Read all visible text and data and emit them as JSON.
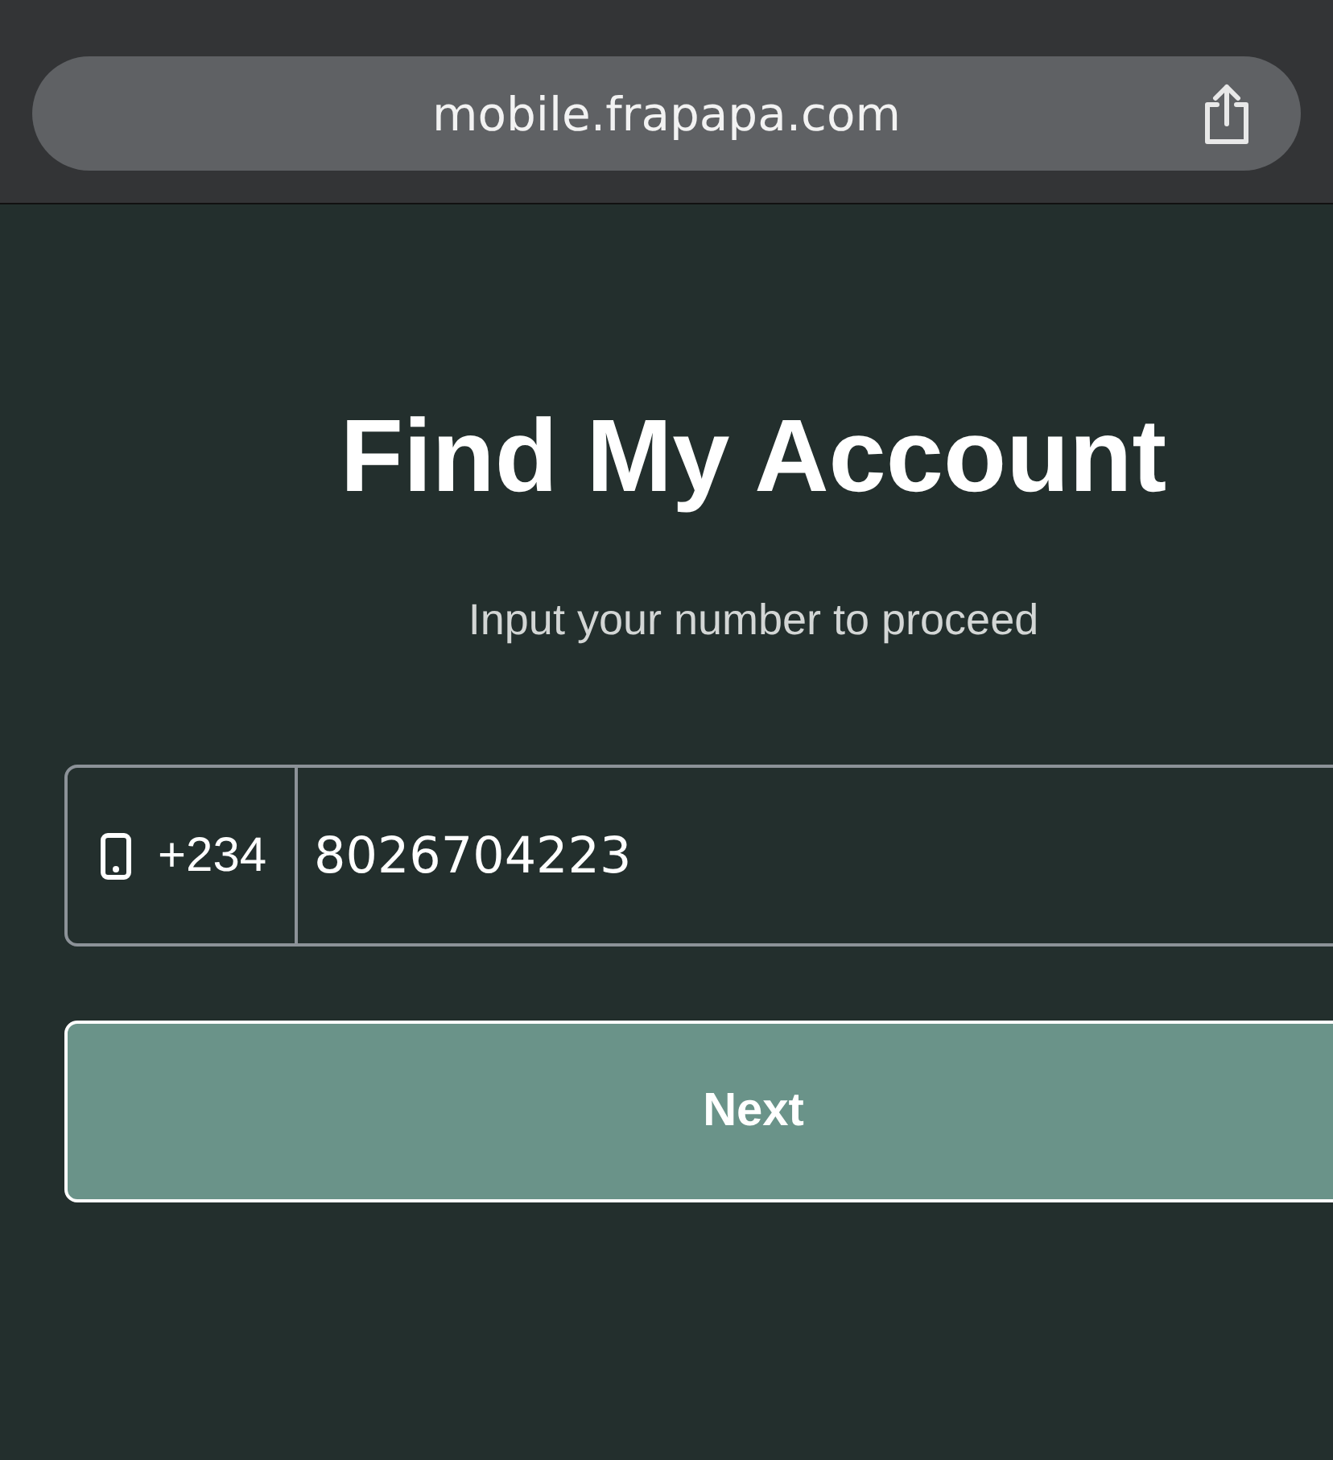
{
  "browser": {
    "url": "mobile.frapapa.com"
  },
  "page": {
    "title": "Find My Account",
    "subtitle": "Input your number to proceed",
    "phone_field": {
      "country_code": "+234",
      "value": "8026704223"
    },
    "buttons": [
      "Next"
    ]
  }
}
